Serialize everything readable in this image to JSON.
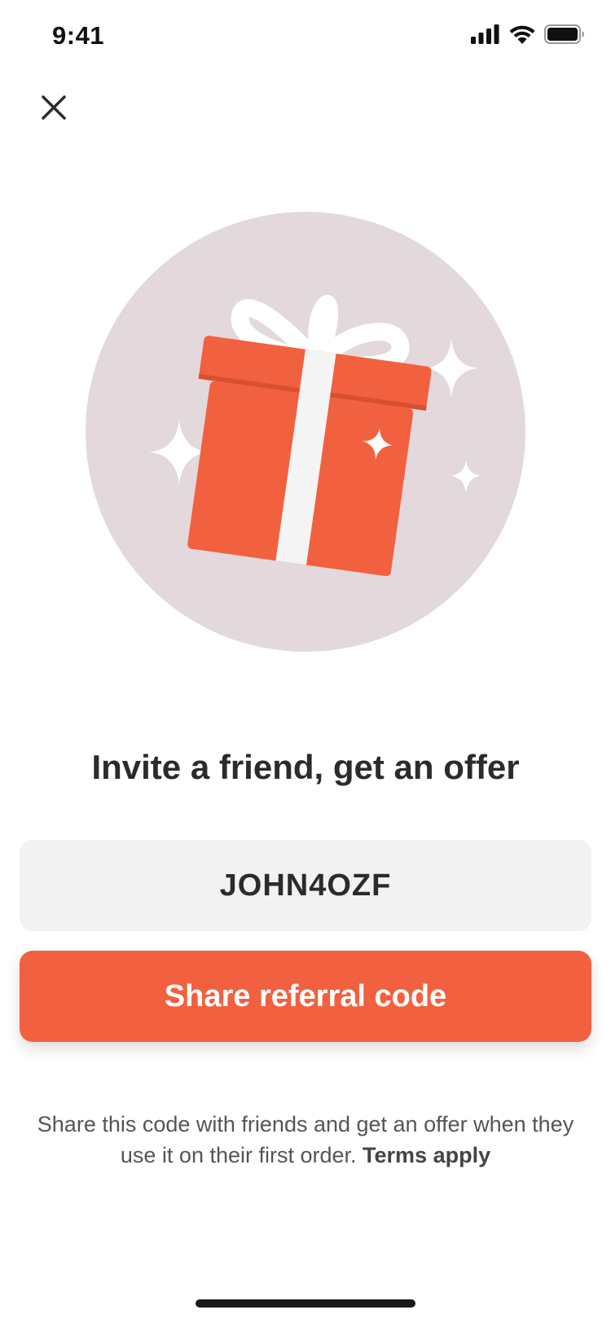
{
  "status_bar": {
    "time": "9:41"
  },
  "close_button": {
    "icon": "close-icon"
  },
  "illustration": {
    "subject": "gift-icon",
    "circle_color": "#e3d8db",
    "box_color": "#f1613f",
    "ribbon_color": "#ffffff"
  },
  "heading": "Invite a friend, get an offer",
  "referral_code": "JOHN4OZF",
  "share_button": {
    "label": "Share referral code",
    "color": "#f1613f"
  },
  "description": {
    "text": "Share this code with friends and get an offer when they use it on their first order.",
    "terms_link": "Terms apply"
  }
}
